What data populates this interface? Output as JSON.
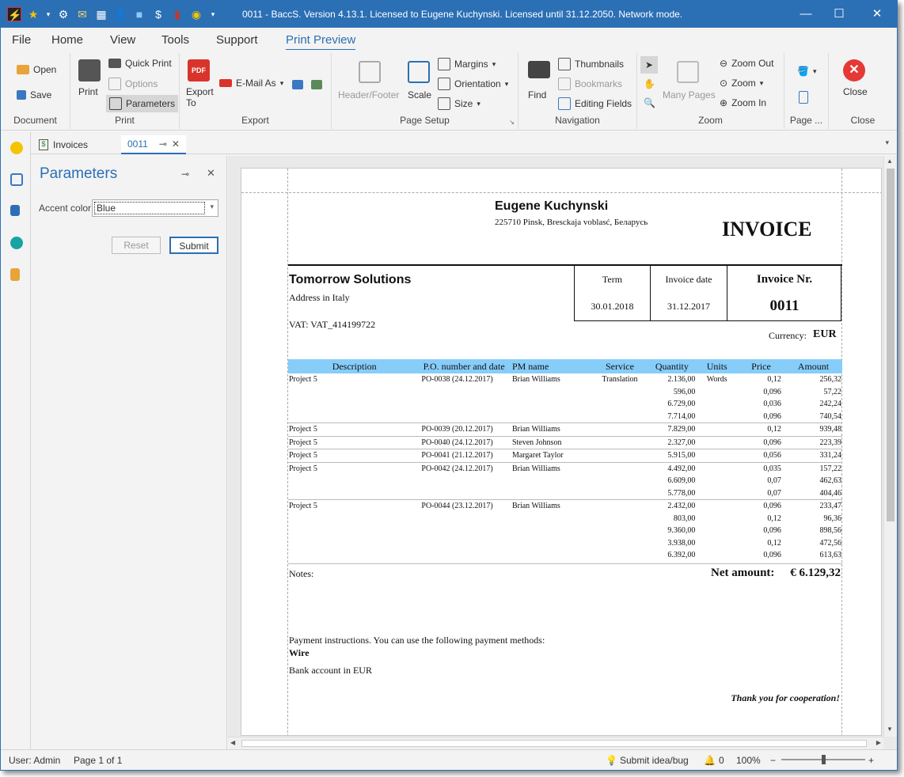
{
  "window": {
    "title": "0011 - BaccS. Version 4.13.1. Licensed to Eugene Kuchynski. Licensed until 31.12.2050. Network mode.",
    "minimize": "—",
    "maximize": "☐",
    "close": "✕"
  },
  "menu": [
    "File",
    "Home",
    "View",
    "Tools",
    "Support",
    "Print Preview"
  ],
  "ribbon": {
    "document": {
      "label": "Document",
      "open": "Open",
      "save": "Save"
    },
    "print": {
      "label": "Print",
      "print": "Print",
      "quick_print": "Quick Print",
      "options": "Options",
      "parameters": "Parameters"
    },
    "export": {
      "label": "Export",
      "export_to": "Export To",
      "email_as": "E-Mail As"
    },
    "page_setup": {
      "label": "Page Setup",
      "header_footer": "Header/Footer",
      "scale": "Scale",
      "margins": "Margins",
      "orientation": "Orientation",
      "size": "Size"
    },
    "navigation": {
      "label": "Navigation",
      "find": "Find",
      "thumbnails": "Thumbnails",
      "bookmarks": "Bookmarks",
      "editing_fields": "Editing Fields"
    },
    "zoom": {
      "label": "Zoom",
      "many_pages": "Many Pages",
      "zoom_out": "Zoom Out",
      "zoom": "Zoom",
      "zoom_in": "Zoom In"
    },
    "page": {
      "label": "Page ..."
    },
    "close": {
      "label": "Close",
      "close": "Close"
    }
  },
  "tabs": [
    {
      "label": "Invoices"
    },
    {
      "label": "0011"
    }
  ],
  "parameters": {
    "title": "Parameters",
    "accent_label": "Accent color",
    "accent_value": "Blue",
    "reset": "Reset",
    "submit": "Submit"
  },
  "invoice": {
    "company_name": "Eugene Kuchynski",
    "company_address": "225710 Pinsk, Bresckaja voblasć, Беларусь",
    "title": "INVOICE",
    "customer_name": "Tomorrow Solutions",
    "customer_address": "Address in Italy",
    "vat": "VAT: VAT_414199722",
    "term_label": "Term",
    "term_value": "30.01.2018",
    "date_label": "Invoice date",
    "date_value": "31.12.2017",
    "nr_label": "Invoice Nr.",
    "nr_value": "0011",
    "currency_label": "Currency:",
    "currency_value": "EUR",
    "columns": [
      "Description",
      "P.O. number and date",
      "PM name",
      "Service",
      "Quantity",
      "Units",
      "Price",
      "Amount"
    ],
    "rows": [
      [
        "Project 5",
        "PO-0038 (24.12.2017)",
        "Brian Williams",
        "Translation",
        "2.136,00",
        "Words",
        "0,12",
        "256,32"
      ],
      [
        "",
        "",
        "",
        "",
        "596,00",
        "",
        "0,096",
        "57,22"
      ],
      [
        "",
        "",
        "",
        "",
        "6.729,00",
        "",
        "0,036",
        "242,24"
      ],
      [
        "",
        "",
        "",
        "",
        "7.714,00",
        "",
        "0,096",
        "740,54"
      ],
      [
        "Project 5",
        "PO-0039 (20.12.2017)",
        "Brian Williams",
        "",
        "7.829,00",
        "",
        "0,12",
        "939,48"
      ],
      [
        "Project 5",
        "PO-0040 (24.12.2017)",
        "Steven Johnson",
        "",
        "2.327,00",
        "",
        "0,096",
        "223,39"
      ],
      [
        "Project 5",
        "PO-0041 (21.12.2017)",
        "Margaret Taylor",
        "",
        "5.915,00",
        "",
        "0,056",
        "331,24"
      ],
      [
        "Project 5",
        "PO-0042 (24.12.2017)",
        "Brian Williams",
        "",
        "4.492,00",
        "",
        "0,035",
        "157,22"
      ],
      [
        "",
        "",
        "",
        "",
        "6.609,00",
        "",
        "0,07",
        "462,63"
      ],
      [
        "",
        "",
        "",
        "",
        "5.778,00",
        "",
        "0,07",
        "404,46"
      ],
      [
        "Project 5",
        "PO-0044 (23.12.2017)",
        "Brian Williams",
        "",
        "2.432,00",
        "",
        "0,096",
        "233,47"
      ],
      [
        "",
        "",
        "",
        "",
        "803,00",
        "",
        "0,12",
        "96,36"
      ],
      [
        "",
        "",
        "",
        "",
        "9.360,00",
        "",
        "0,096",
        "898,56"
      ],
      [
        "",
        "",
        "",
        "",
        "3.938,00",
        "",
        "0,12",
        "472,56"
      ],
      [
        "",
        "",
        "",
        "",
        "6.392,00",
        "",
        "0,096",
        "613,63"
      ]
    ],
    "group_starts": [
      0,
      4,
      5,
      6,
      7,
      10
    ],
    "notes_label": "Notes:",
    "net_label": "Net amount:",
    "net_value": "€ 6.129,32",
    "payment_text": "Payment instructions. You can use the following payment methods:",
    "payment_method": "Wire",
    "bank_text": "Bank account in EUR",
    "thanks": "Thank you for cooperation!"
  },
  "status": {
    "user": "User: Admin",
    "page": "Page 1 of 1",
    "submit_idea": "Submit idea/bug",
    "notifications": "0",
    "zoom": "100%",
    "zoom_level": 0.5
  },
  "colors": {
    "accent": "#2b6fb5",
    "table_header": "#87cdf9",
    "close_red": "#e53935",
    "pdf_red": "#d9342b"
  }
}
